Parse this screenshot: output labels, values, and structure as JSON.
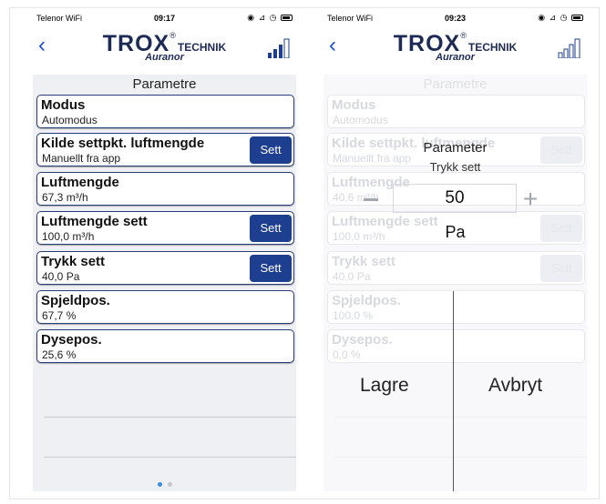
{
  "colors": {
    "accent": "#1e3f8f",
    "back": "#1a4fd9",
    "background": "#eff0f3"
  },
  "left_screen": {
    "status": {
      "carrier": "Telenor WiFi",
      "time": "09:17"
    },
    "logo": {
      "brand": "TROX",
      "suffix": "TECHNIK",
      "reg": "®",
      "sub": "Auranor"
    },
    "title": "Parametre",
    "params": [
      {
        "name": "Modus",
        "value": "Automodus",
        "button": ""
      },
      {
        "name": "Kilde settpkt. luftmengde",
        "value": "Manuellt fra app",
        "button": "Sett"
      },
      {
        "name": "Luftmengde",
        "value": "67,3 m³/h",
        "button": ""
      },
      {
        "name": "Luftmengde sett",
        "value": "100,0 m³/h",
        "button": "Sett"
      },
      {
        "name": "Trykk sett",
        "value": "40,0 Pa",
        "button": "Sett"
      },
      {
        "name": "Spjeldpos.",
        "value": "67,7 %",
        "button": ""
      },
      {
        "name": "Dysepos.",
        "value": "25,6 %",
        "button": ""
      }
    ]
  },
  "right_screen": {
    "status": {
      "carrier": "Telenor WiFi",
      "time": "09:23"
    },
    "logo": {
      "brand": "TROX",
      "suffix": "TECHNIK",
      "reg": "®",
      "sub": "Auranor"
    },
    "title": "Parametre",
    "params": [
      {
        "name": "Modus",
        "value": "Automodus",
        "button": ""
      },
      {
        "name": "Kilde settpkt. luftmengde",
        "value": "Manuellt fra app",
        "button": "Sett"
      },
      {
        "name": "Luftmengde",
        "value": "40,6 m³/h",
        "button": ""
      },
      {
        "name": "Luftmengde sett",
        "value": "100,0 m³/h",
        "button": "Sett"
      },
      {
        "name": "Trykk sett",
        "value": "40,0 Pa",
        "button": "Sett"
      },
      {
        "name": "Spjeldpos.",
        "value": "100,0 %",
        "button": ""
      },
      {
        "name": "Dysepos.",
        "value": "0,0 %",
        "button": ""
      }
    ],
    "dialog": {
      "title": "Parameter",
      "subtitle": "Trykk sett",
      "value": "50",
      "unit": "Pa",
      "save": "Lagre",
      "cancel": "Avbryt"
    }
  }
}
